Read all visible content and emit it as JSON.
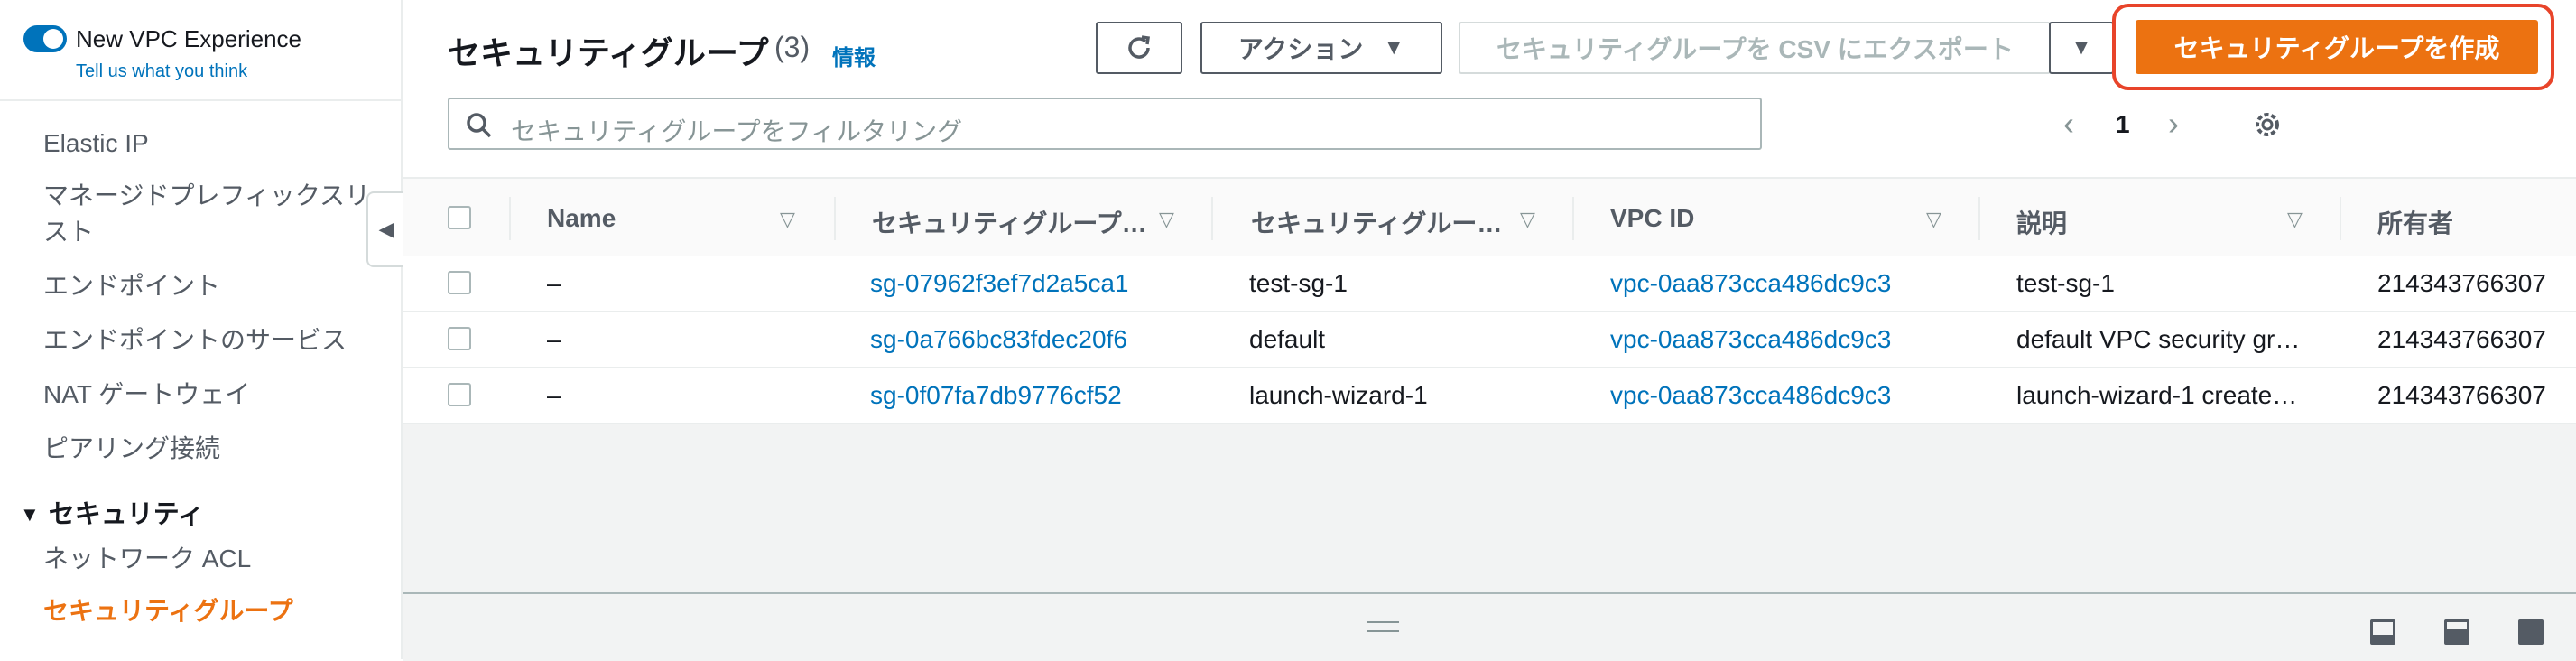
{
  "sidebar": {
    "toggle_title": "New VPC Experience",
    "toggle_link": "Tell us what you think",
    "items": [
      {
        "label": "Elastic IP"
      },
      {
        "label": "マネージドプレフィックスリ"
      },
      {
        "label": "スト"
      },
      {
        "label": "エンドポイント"
      },
      {
        "label": "エンドポイントのサービス"
      },
      {
        "label": "NAT ゲートウェイ"
      },
      {
        "label": "ピアリング接続"
      }
    ],
    "section_title": "セキュリティ",
    "section_items": [
      {
        "label": "ネットワーク ACL"
      },
      {
        "label": "セキュリティグループ"
      }
    ]
  },
  "header": {
    "title": "セキュリティグループ",
    "count": "(3)",
    "info": "情報",
    "actions_label": "アクション",
    "export_label": "セキュリティグループを CSV にエクスポート",
    "create_label": "セキュリティグループを作成"
  },
  "filter": {
    "placeholder": "セキュリティグループをフィルタリング"
  },
  "pagination": {
    "current_page": "1"
  },
  "table": {
    "columns": [
      "Name",
      "セキュリティグループ…",
      "セキュリティグルー…",
      "VPC ID",
      "説明",
      "所有者"
    ],
    "rows": [
      {
        "name": "–",
        "sg_id": "sg-07962f3ef7d2a5ca1",
        "sg_name": "test-sg-1",
        "vpc_id": "vpc-0aa873cca486dc9c3",
        "description": "test-sg-1",
        "owner": "214343766307"
      },
      {
        "name": "–",
        "sg_id": "sg-0a766bc83fdec20f6",
        "sg_name": "default",
        "vpc_id": "vpc-0aa873cca486dc9c3",
        "description": "default VPC security gr…",
        "owner": "214343766307"
      },
      {
        "name": "–",
        "sg_id": "sg-0f07fa7db9776cf52",
        "sg_name": "launch-wizard-1",
        "vpc_id": "vpc-0aa873cca486dc9c3",
        "description": "launch-wizard-1 create…",
        "owner": "214343766307"
      }
    ]
  },
  "colors": {
    "accent_orange": "#ec7211",
    "link_blue": "#0073bb",
    "highlight_red": "#e8442a"
  },
  "icons": {
    "refresh": "refresh-icon",
    "caret": "caret-down-icon",
    "search": "search-icon",
    "settings": "gear-icon"
  }
}
